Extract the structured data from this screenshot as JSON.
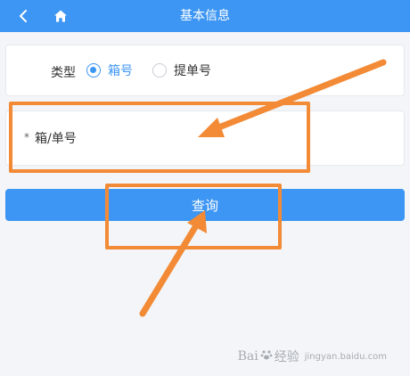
{
  "header": {
    "title": "基本信息",
    "back_icon": "chevron-left-icon",
    "home_icon": "home-icon",
    "background": "#3d96f3"
  },
  "type_section": {
    "label": "类型",
    "options": [
      {
        "label": "箱号",
        "selected": true
      },
      {
        "label": "提单号",
        "selected": false
      }
    ]
  },
  "input_section": {
    "required_mark": "*",
    "label": "箱/单号",
    "value": "",
    "placeholder": ""
  },
  "query_button": {
    "label": "查询",
    "color": "#3d96f3"
  },
  "annotation": {
    "color": "#f28a36"
  },
  "watermark": {
    "brand_prefix": "Bai",
    "brand_suffix": "经验",
    "sub": "jingyan.baidu.com"
  }
}
